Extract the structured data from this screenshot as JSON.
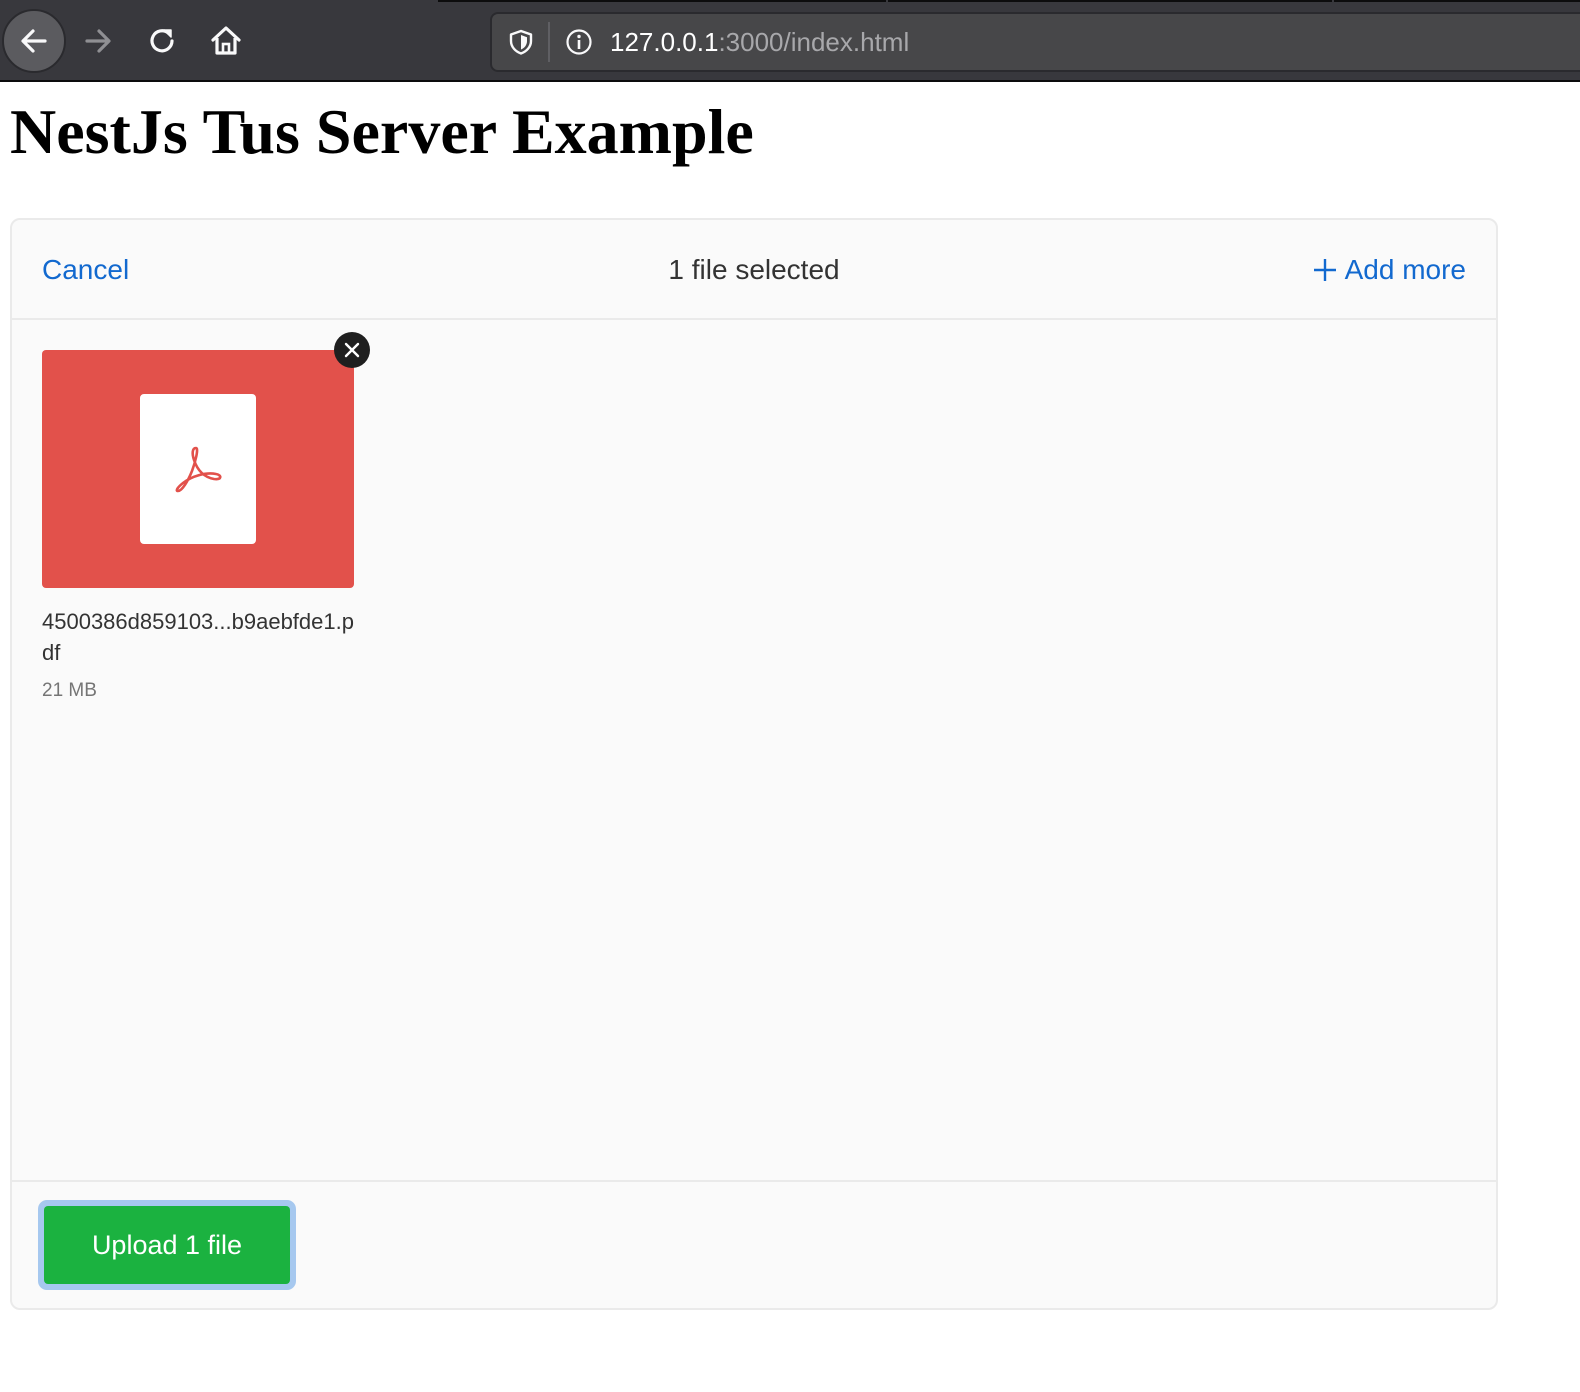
{
  "browser": {
    "url_host": "127.0.0.1",
    "url_rest": ":3000/index.html",
    "icons": {
      "back": "arrow-left-icon",
      "forward": "arrow-right-icon",
      "reload": "reload-icon",
      "home": "home-icon",
      "shield": "shield-icon",
      "info": "info-icon"
    },
    "colors": {
      "toolbar_bg": "#38383d",
      "urlbar_bg": "#474749"
    }
  },
  "page": {
    "title": "NestJs Tus Server Example"
  },
  "dashboard": {
    "header": {
      "cancel_label": "Cancel",
      "status": "1 file selected",
      "add_more_label": "Add more"
    },
    "files": [
      {
        "name": "4500386d859103...b9aebfde1.pdf",
        "size": "21 MB",
        "type_icon": "pdf-icon",
        "remove_icon": "close-icon"
      }
    ],
    "footer": {
      "upload_label": "Upload 1 file"
    },
    "colors": {
      "link": "#1269cf",
      "preview_bg": "#e2514b",
      "upload_bg": "#1bb240"
    }
  }
}
